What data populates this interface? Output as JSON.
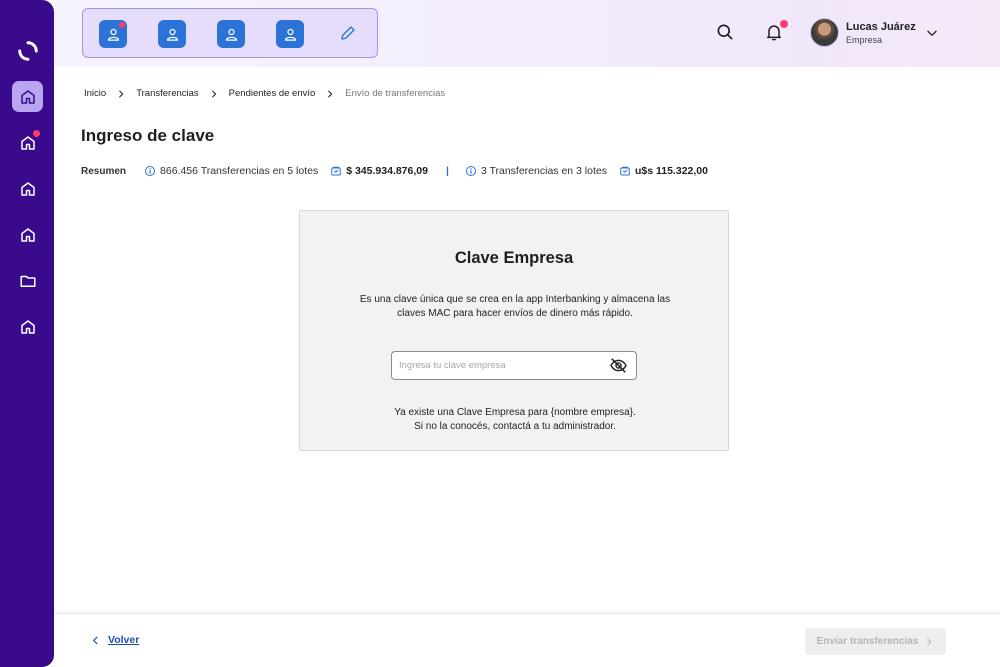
{
  "sidebar": {
    "logo_icon": "brand-logo-icon",
    "items": [
      {
        "icon": "home-icon",
        "active": true,
        "badge": false
      },
      {
        "icon": "home-icon",
        "active": false,
        "badge": true
      },
      {
        "icon": "home-icon",
        "active": false,
        "badge": false
      },
      {
        "icon": "home-icon",
        "active": false,
        "badge": false
      },
      {
        "icon": "folder-icon",
        "active": false,
        "badge": false
      },
      {
        "icon": "home-icon",
        "active": false,
        "badge": false
      }
    ]
  },
  "header": {
    "quick_actions": [
      {
        "icon": "user-icon",
        "badge": true
      },
      {
        "icon": "user-icon",
        "badge": false
      },
      {
        "icon": "user-icon",
        "badge": false
      },
      {
        "icon": "user-icon",
        "badge": false
      },
      {
        "icon": "pencil-icon",
        "badge": false
      }
    ],
    "search_icon": "search-icon",
    "bell_icon": "bell-icon",
    "user": {
      "name": "Lucas Juárez",
      "role": "Empresa"
    }
  },
  "breadcrumb": {
    "items": [
      "Inicio",
      "Transferencias",
      "Pendientes de envío"
    ],
    "current": "Envío de transferencias"
  },
  "page": {
    "title": "Ingreso de clave"
  },
  "summary": {
    "label": "Resumen",
    "ars_count": "866.456 Transferencias en 5 lotes",
    "ars_amount": "$ 345.934.876,09",
    "usd_count": "3 Transferencias en 3 lotes",
    "usd_amount": "u$s 115.322,00"
  },
  "card": {
    "title": "Clave Empresa",
    "desc_line1": "Es una clave única que se crea en la app Interbanking y almacena las",
    "desc_line2": "claves MAC para hacer envíos de dinero más rápido.",
    "input_placeholder": "Ingresa tu clave empresa",
    "input_value": "",
    "note_line1": "Ya existe una Clave Empresa para {nombre empresa}.",
    "note_line2": "Si no la conocés, contactá a tu administrador."
  },
  "footer": {
    "back_label": "Volver",
    "send_label": "Enviar transferencias"
  },
  "colors": {
    "sidebar": "#3a0a8c",
    "accent_blue": "#2b73d6",
    "badge": "#ff3b6b",
    "link": "#1c4fb3"
  }
}
